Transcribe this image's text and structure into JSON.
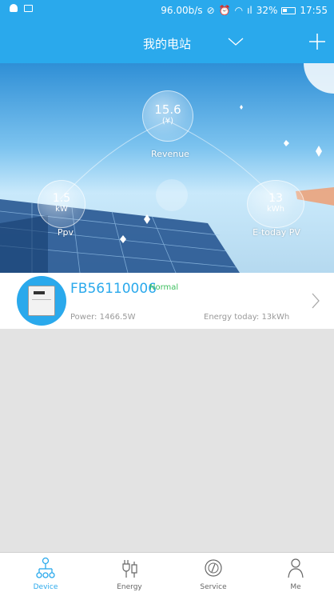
{
  "status_bar": {
    "net_speed": "96.00b/s",
    "signal": "ıl",
    "battery_pct": "32%",
    "time": "17:55"
  },
  "nav": {
    "title": "我的电站",
    "dropdown_icon": "chevron-down-icon",
    "add_icon": "plus-icon"
  },
  "hero": {
    "revenue": {
      "value": "15.6",
      "unit": "(¥)",
      "label": "Revenue"
    },
    "ppv": {
      "value": "1.5",
      "unit": "kW",
      "label": "Ppv"
    },
    "etoday": {
      "value": "13",
      "unit": "kWh",
      "label": "E-today PV"
    }
  },
  "device": {
    "name": "FB56110006",
    "status": "Normal",
    "power": "Power: 1466.5W",
    "energy_today": "Energy today: 13kWh"
  },
  "tabs": [
    {
      "label": "Device",
      "icon": "device-network-icon",
      "active": true
    },
    {
      "label": "Energy",
      "icon": "energy-plug-icon",
      "active": false
    },
    {
      "label": "Service",
      "icon": "service-compass-icon",
      "active": false
    },
    {
      "label": "Me",
      "icon": "person-icon",
      "active": false
    }
  ],
  "colors": {
    "accent": "#2aa9ec",
    "status_ok": "#3dbf5f",
    "page_bg": "#e3e3e3"
  }
}
